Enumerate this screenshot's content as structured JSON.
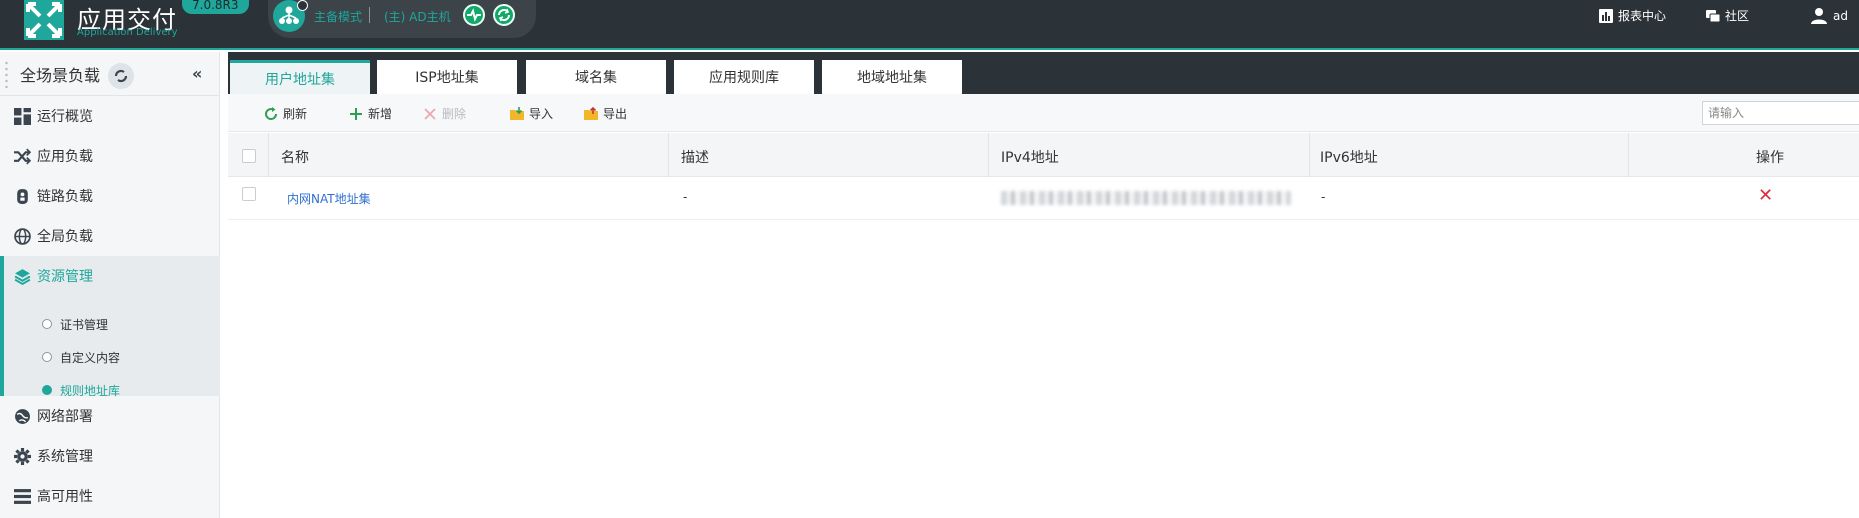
{
  "header": {
    "title": "应用交付",
    "subtitle": "Application Delivery",
    "version": "7.0.8R3",
    "ha_mode": "主备模式",
    "ha_host": "(主) AD主机",
    "report_center": "报表中心",
    "community": "社区",
    "user": "ad"
  },
  "sidebar": {
    "title": "全场景负载",
    "items": [
      {
        "label": "运行概览",
        "icon": "dashboard-icon"
      },
      {
        "label": "应用负载",
        "icon": "shuffle-icon"
      },
      {
        "label": "链路负载",
        "icon": "link-device-icon"
      },
      {
        "label": "全局负载",
        "icon": "globe-icon"
      },
      {
        "label": "资源管理",
        "icon": "layers-icon"
      },
      {
        "label": "网络部署",
        "icon": "network-globe-icon"
      },
      {
        "label": "系统管理",
        "icon": "gear-icon"
      },
      {
        "label": "高可用性",
        "icon": "list-icon"
      }
    ],
    "sub_items": [
      {
        "label": "证书管理"
      },
      {
        "label": "自定义内容"
      },
      {
        "label": "规则地址库"
      }
    ]
  },
  "tabs": [
    "用户地址集",
    "ISP地址集",
    "域名集",
    "应用规则库",
    "地域地址集"
  ],
  "toolbar": {
    "refresh": "刷新",
    "add": "新增",
    "delete": "删除",
    "import": "导入",
    "export": "导出",
    "search_placeholder": "请输入"
  },
  "table": {
    "columns": [
      "名称",
      "描述",
      "IPv4地址",
      "IPv6地址",
      "操作"
    ],
    "rows": [
      {
        "name": "内网NAT地址集",
        "desc": "-",
        "ipv6": "-",
        "action": "✕"
      }
    ]
  },
  "colors": {
    "accent": "#1ea79a",
    "header_bg": "#2b3238",
    "link": "#2f6fd0",
    "danger": "#e02b3c"
  }
}
